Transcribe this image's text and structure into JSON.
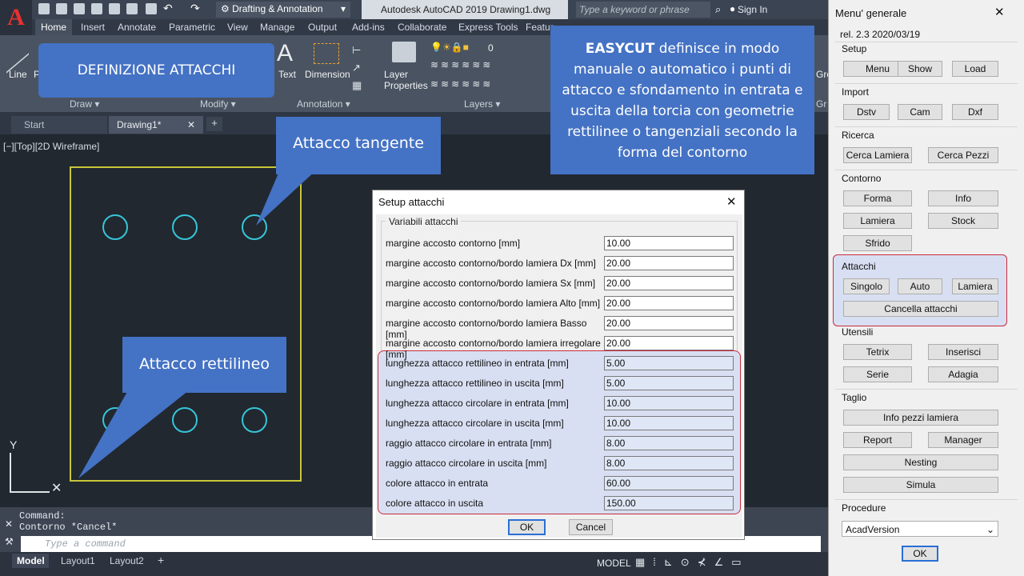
{
  "app": {
    "workspace": "Drafting & Annotation",
    "title": "Autodesk AutoCAD 2019   Drawing1.dwg",
    "search_placeholder": "Type a keyword or phrase",
    "signin": "Sign In"
  },
  "ribbon_tabs": [
    "Home",
    "Insert",
    "Annotate",
    "Parametric",
    "View",
    "Manage",
    "Output",
    "Add-ins",
    "Collaborate",
    "Express Tools",
    "Featur"
  ],
  "ribbon": {
    "line": "Line",
    "text": "Text",
    "dimension": "Dimension",
    "layer_properties": "Layer\nProperties",
    "layer_value": "0",
    "panels": {
      "draw": "Draw ▾",
      "modify": "Modify ▾",
      "annotation": "Annotation ▾",
      "layers": "Layers ▾",
      "gro": "Gro",
      "gr": "Gr"
    }
  },
  "doc_tabs": {
    "start": "Start",
    "drawing": "Drawing1*"
  },
  "viewport_label": "[−][Top][2D Wireframe]",
  "command": {
    "line1": "Command:",
    "line2": "Contorno *Cancel*",
    "placeholder": "Type a command"
  },
  "status": {
    "tabs": [
      "Model",
      "Layout1",
      "Layout2"
    ],
    "model": "MODEL"
  },
  "callouts": {
    "definizione": "DEFINIZIONE ATTACCHI",
    "tangente": "Attacco tangente",
    "rettilineo": "Attacco rettilineo",
    "easycut_bold": "EASYCUT",
    "easycut_text": " definisce in modo manuale o automatico i punti di attacco e sfondamento in entrata e uscita della torcia con geometrie rettilinee o tangenziali secondo la forma del contorno"
  },
  "dialog": {
    "title": "Setup attacchi",
    "group": "Variabili attacchi",
    "ok": "OK",
    "cancel": "Cancel",
    "rows": [
      {
        "label": "margine accosto contorno [mm]",
        "value": "10.00"
      },
      {
        "label": "margine accosto contorno/bordo lamiera Dx [mm]",
        "value": "20.00"
      },
      {
        "label": "margine accosto contorno/bordo lamiera Sx [mm]",
        "value": "20.00"
      },
      {
        "label": "margine accosto contorno/bordo lamiera Alto [mm]",
        "value": "20.00"
      },
      {
        "label": "margine accosto contorno/bordo lamiera Basso [mm]",
        "value": "20.00"
      },
      {
        "label": "margine accosto contorno/bordo lamiera irregolare [mm]",
        "value": "20.00"
      },
      {
        "label": "lunghezza attacco rettilineo in entrata [mm]",
        "value": "5.00"
      },
      {
        "label": "lunghezza attacco rettilineo in uscita [mm]",
        "value": "5.00"
      },
      {
        "label": "lunghezza attacco circolare in entrata [mm]",
        "value": "10.00"
      },
      {
        "label": "lunghezza attacco circolare in uscita [mm]",
        "value": "10.00"
      },
      {
        "label": "raggio attacco circolare in entrata [mm]",
        "value": "8.00"
      },
      {
        "label": "raggio attacco circolare in uscita [mm]",
        "value": "8.00"
      },
      {
        "label": "colore attacco in entrata",
        "value": "60.00"
      },
      {
        "label": "colore attacco in uscita",
        "value": "150.00"
      }
    ]
  },
  "menu": {
    "title": "Menu' generale",
    "version": "rel. 2.3 2020/03/19",
    "setup": "Setup",
    "menu": "Menu",
    "show": "Show",
    "load": "Load",
    "import": "Import",
    "dstv": "Dstv",
    "cam": "Cam",
    "dxf": "Dxf",
    "ricerca": "Ricerca",
    "cerca_lamiera": "Cerca Lamiera",
    "cerca_pezzi": "Cerca Pezzi",
    "contorno": "Contorno",
    "forma": "Forma",
    "info": "Info",
    "lamiera": "Lamiera",
    "stock": "Stock",
    "sfrido": "Sfrido",
    "attacchi": "Attacchi",
    "singolo": "Singolo",
    "auto": "Auto",
    "att_lamiera": "Lamiera",
    "cancella": "Cancella attacchi",
    "utensili": "Utensili",
    "tetrix": "Tetrix",
    "inserisci": "Inserisci",
    "serie": "Serie",
    "adagia": "Adagia",
    "taglio": "Taglio",
    "info_pezzi": "Info pezzi lamiera",
    "report": "Report",
    "manager": "Manager",
    "nesting": "Nesting",
    "simula": "Simula",
    "procedure": "Procedure",
    "acad": "AcadVersion",
    "ok": "OK"
  }
}
